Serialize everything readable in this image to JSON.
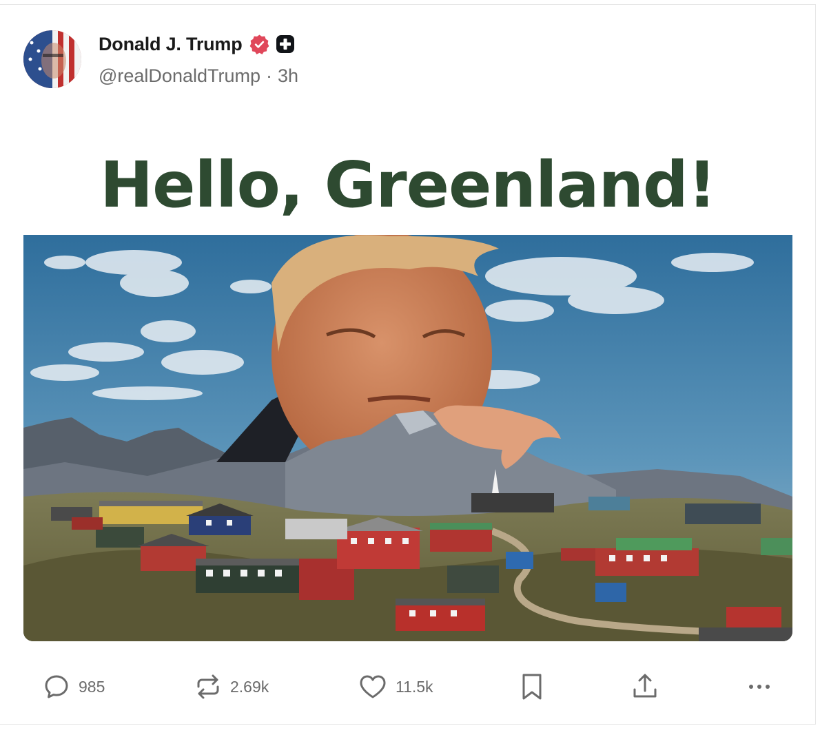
{
  "post": {
    "author_name": "Donald J. Trump",
    "handle": "@realDonaldTrump",
    "separator": "·",
    "time": "3h",
    "badges": [
      "verified-badge-icon",
      "plus-badge-icon"
    ],
    "image": {
      "headline": "Hello, Greenland!",
      "title_color": "#2e4a31"
    }
  },
  "actions": {
    "replies": "985",
    "reposts": "2.69k",
    "likes": "11.5k"
  },
  "colors": {
    "verified": "#e0475a",
    "text_secondary": "#6b6b6b",
    "icon": "#6b6b6b"
  }
}
